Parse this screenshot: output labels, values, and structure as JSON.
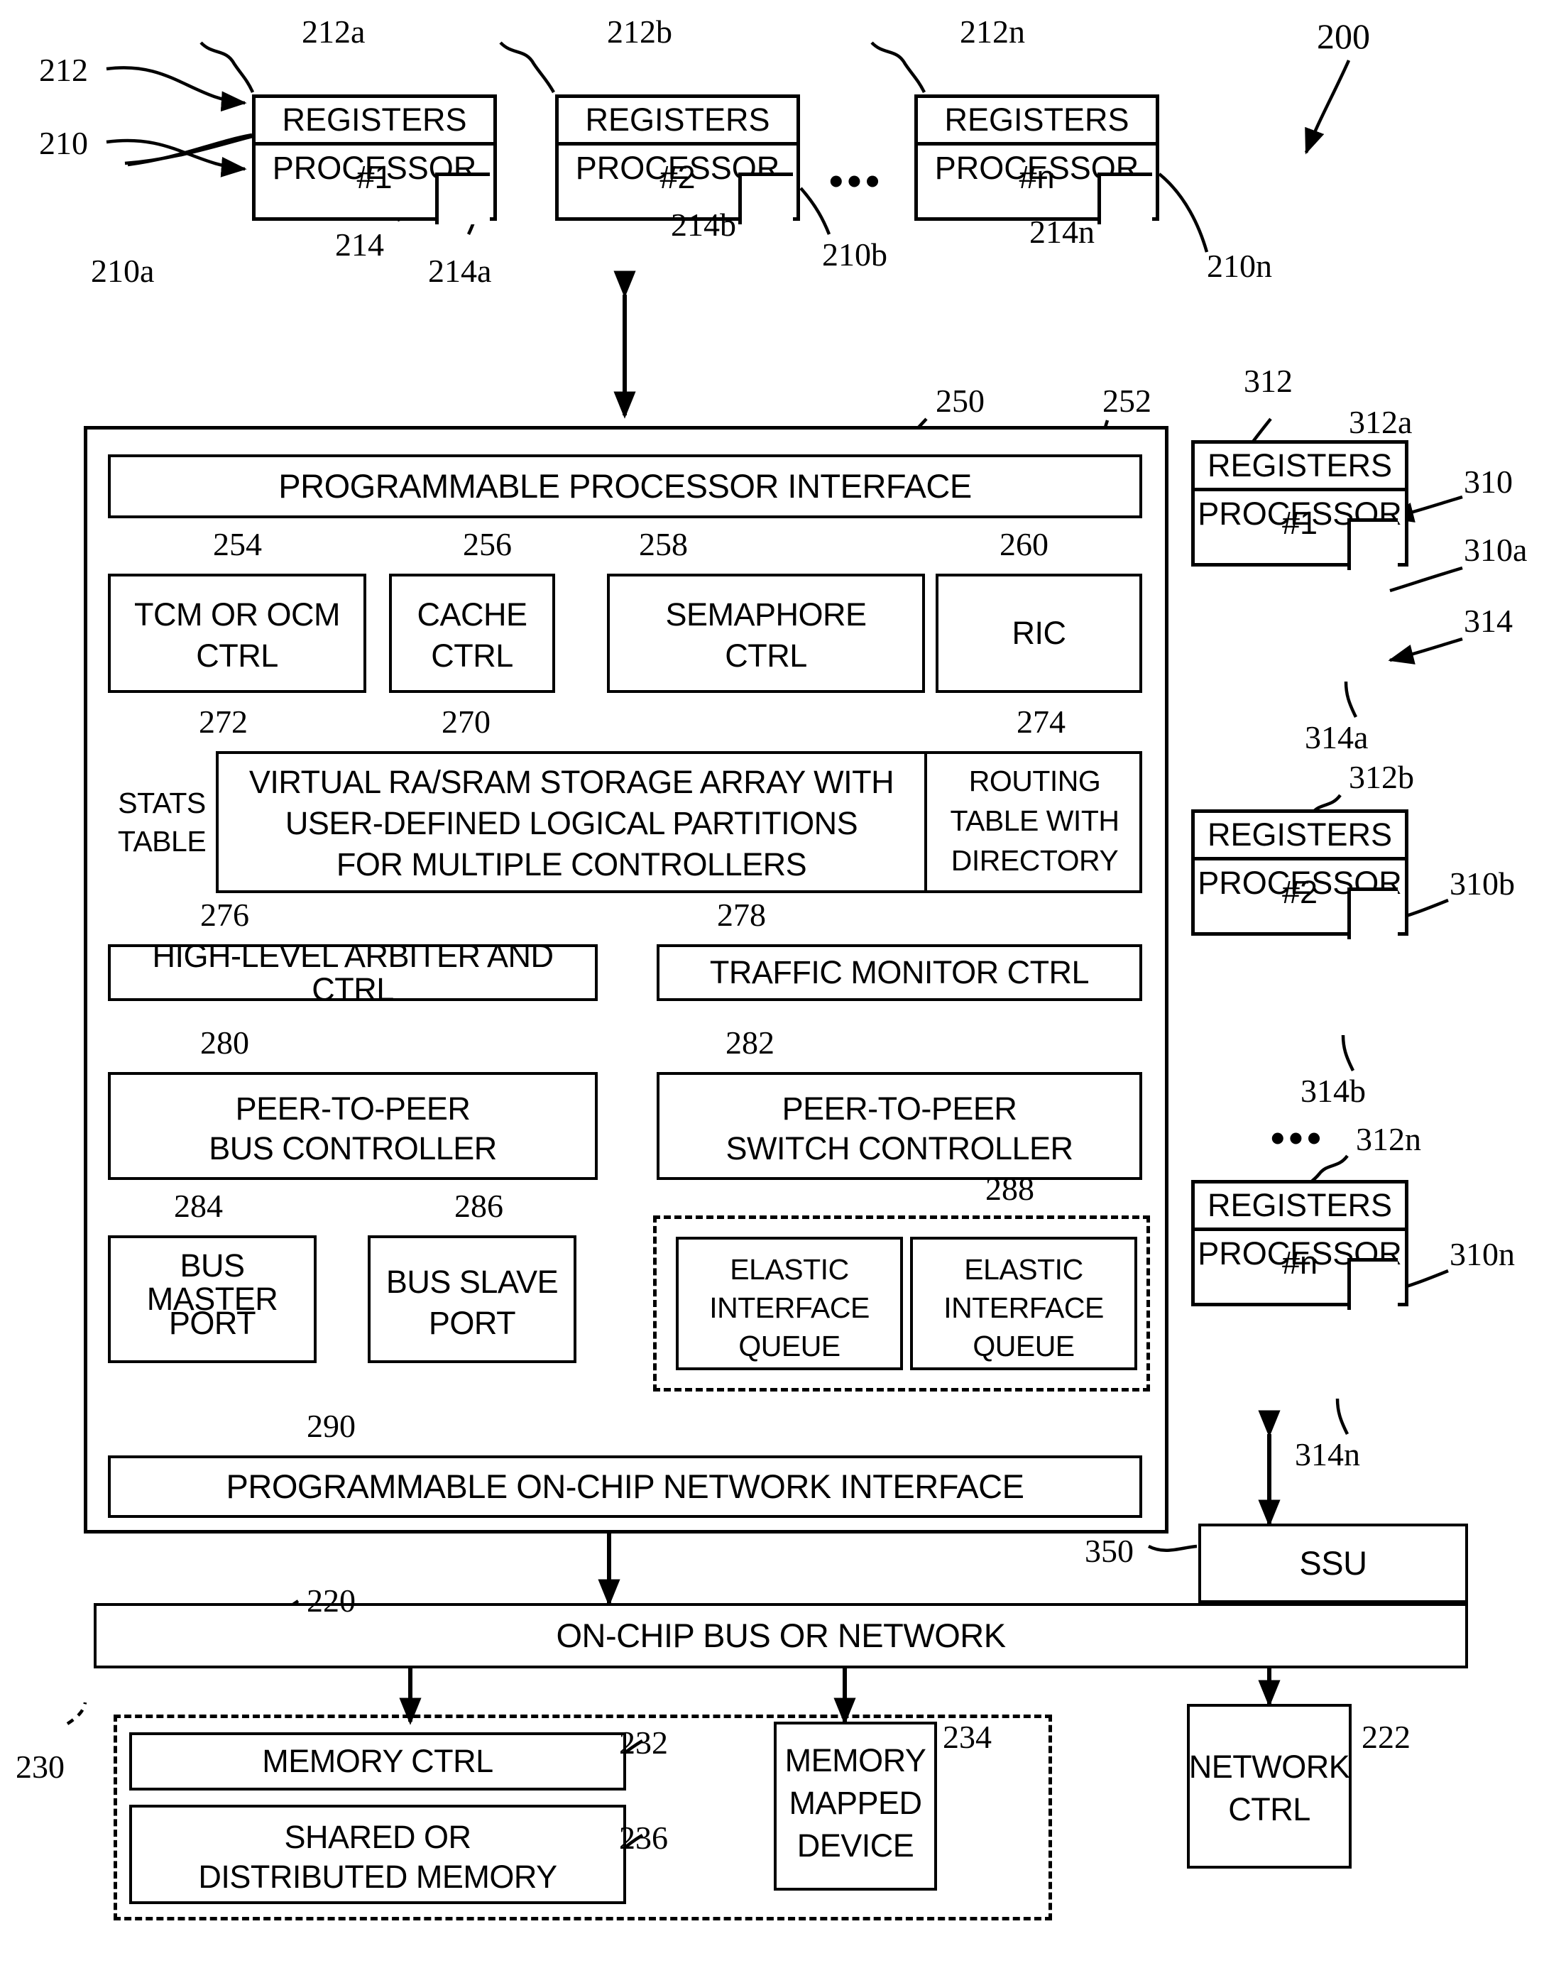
{
  "figure": {
    "number": "200",
    "top_processors": [
      {
        "registers": "REGISTERS",
        "processor": "PROCESSOR",
        "number": "#1",
        "ref_registers": "212a",
        "ref_processor": "210a",
        "ref_port": "214a"
      },
      {
        "registers": "REGISTERS",
        "processor": "PROCESSOR",
        "number": "#2",
        "ref_registers": "212b",
        "ref_processor": "210b",
        "ref_port": "214b"
      },
      {
        "registers": "REGISTERS",
        "processor": "PROCESSOR",
        "number": "#n",
        "ref_registers": "212n",
        "ref_processor": "210n",
        "ref_port": "214n"
      }
    ],
    "top_ellipsis": "•••",
    "top_refs": {
      "registers_generic": "212",
      "processor_generic": "210",
      "port_generic": "214"
    },
    "right_processors": [
      {
        "registers": "REGISTERS",
        "processor": "PROCESSOR",
        "number": "#1",
        "ref_registers": "312a",
        "ref_processor": "310a",
        "ref_port": "314a"
      },
      {
        "registers": "REGISTERS",
        "processor": "PROCESSOR",
        "number": "#2",
        "ref_registers": "312b",
        "ref_processor": "310b",
        "ref_port": "314b"
      },
      {
        "registers": "REGISTERS",
        "processor": "PROCESSOR",
        "number": "#n",
        "ref_registers": "312n",
        "ref_processor": "310n",
        "ref_port": "314n"
      }
    ],
    "right_ellipsis": "•••",
    "right_refs": {
      "registers_generic": "312",
      "processor_generic": "310",
      "port_generic": "314"
    },
    "main_unit": {
      "ref": "250",
      "processor_interface": {
        "label": "PROGRAMMABLE PROCESSOR INTERFACE",
        "ref": "252"
      },
      "controllers": [
        {
          "label": "TCM OR OCM CTRL",
          "line1": "TCM OR OCM",
          "line2": "CTRL",
          "ref": "254"
        },
        {
          "label": "CACHE CTRL",
          "line1": "CACHE",
          "line2": "CTRL",
          "ref": "256"
        },
        {
          "label": "SEMAPHORE CTRL",
          "line1": "SEMAPHORE",
          "line2": "CTRL",
          "ref": "258"
        },
        {
          "label": "RIC",
          "line1": "RIC",
          "line2": "",
          "ref": "260"
        }
      ],
      "stats_table": {
        "line1": "STATS",
        "line2": "TABLE",
        "ref": "272"
      },
      "storage_array": {
        "line1": "VIRTUAL RA/SRAM STORAGE ARRAY WITH",
        "line2": "USER-DEFINED LOGICAL PARTITIONS",
        "line3": "FOR MULTIPLE CONTROLLERS",
        "ref": "270"
      },
      "routing_table": {
        "line1": "ROUTING",
        "line2": "TABLE WITH",
        "line3": "DIRECTORY",
        "ref": "274"
      },
      "arbiter": {
        "label": "HIGH-LEVEL  ARBITER AND CTRL",
        "ref": "276"
      },
      "traffic_monitor": {
        "label": "TRAFFIC MONITOR CTRL",
        "ref": "278"
      },
      "p2p_bus": {
        "line1": "PEER-TO-PEER",
        "line2": "BUS CONTROLLER",
        "ref": "280"
      },
      "p2p_switch": {
        "line1": "PEER-TO-PEER",
        "line2": "SWITCH CONTROLLER",
        "ref": "282"
      },
      "bus_master": {
        "line1": "BUS MASTER",
        "line2": "PORT",
        "ref": "284"
      },
      "bus_slave": {
        "line1": "BUS SLAVE",
        "line2": "PORT",
        "ref": "286"
      },
      "elastic_group": {
        "ref": "288",
        "queues": [
          {
            "line1": "ELASTIC",
            "line2": "INTERFACE",
            "line3": "QUEUE"
          },
          {
            "line1": "ELASTIC",
            "line2": "INTERFACE",
            "line3": "QUEUE"
          }
        ]
      },
      "network_interface": {
        "label": "PROGRAMMABLE ON-CHIP NETWORK INTERFACE",
        "ref": "290"
      }
    },
    "ssu": {
      "label": "SSU",
      "ref": "350"
    },
    "on_chip_bus": {
      "label": "ON-CHIP BUS OR NETWORK",
      "ref": "220"
    },
    "memory_group": {
      "ref": "230",
      "memory_ctrl": {
        "label": "MEMORY CTRL",
        "ref": "232"
      },
      "shared_memory": {
        "line1": "SHARED OR",
        "line2": "DISTRIBUTED MEMORY",
        "ref": "236"
      },
      "memory_mapped_device": {
        "line1": "MEMORY",
        "line2": "MAPPED",
        "line3": "DEVICE",
        "ref": "234"
      }
    },
    "network_ctrl": {
      "line1": "NETWORK",
      "line2": "CTRL",
      "ref": "222"
    }
  },
  "colors": {
    "line": "#000000",
    "background": "#ffffff"
  }
}
